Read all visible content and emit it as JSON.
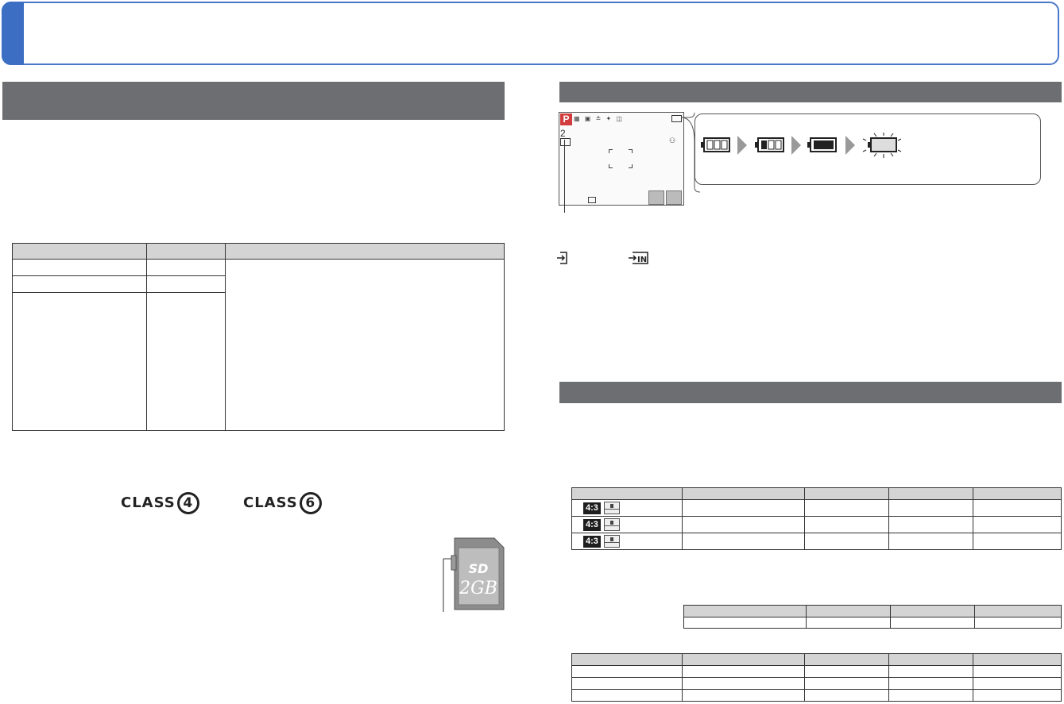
{
  "card_classes": [
    "CLASS",
    "CLASS"
  ],
  "class_numbers": [
    "4",
    "6"
  ],
  "sd_card": {
    "brand": "SD",
    "capacity": "2GB"
  },
  "lcd": {
    "mode": "P",
    "count": "2"
  },
  "quality_table": {
    "aspect": [
      "4:3",
      "4:3",
      "4:3"
    ]
  }
}
